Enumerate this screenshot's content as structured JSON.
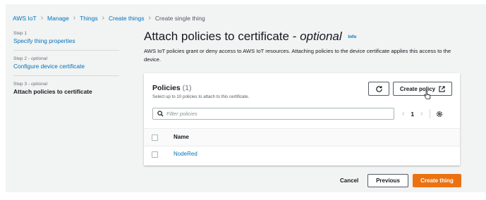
{
  "breadcrumb": {
    "items": [
      "AWS IoT",
      "Manage",
      "Things",
      "Create things"
    ],
    "current": "Create single thing"
  },
  "steps": [
    {
      "number": "Step 1",
      "optional": "",
      "title": "Specify thing properties"
    },
    {
      "number": "Step 2 - ",
      "optional": "optional",
      "title": "Configure device certificate"
    },
    {
      "number": "Step 3 - ",
      "optional": "optional",
      "title": "Attach policies to certificate"
    }
  ],
  "page": {
    "title": "Attach policies to certificate - ",
    "title_optional": "optional",
    "info_label": "Info",
    "description": "AWS IoT policies grant or deny access to AWS IoT resources. Attaching policies to the device certificate applies this access to the device."
  },
  "policies": {
    "title": "Policies",
    "count": "(1)",
    "description": "Select up to 10 policies to attach to this certificate.",
    "create_label": "Create policy",
    "filter_placeholder": "Filter policies",
    "page_number": "1",
    "column_name": "Name",
    "rows": [
      {
        "name": "NodeRed"
      }
    ]
  },
  "footer": {
    "cancel_label": "Cancel",
    "previous_label": "Previous",
    "create_label": "Create thing"
  },
  "colors": {
    "accent": "#0073bb",
    "primary_button": "#ec7211"
  },
  "icons": [
    "refresh-icon",
    "external-link-icon",
    "search-icon",
    "chevron-left-icon",
    "chevron-right-icon",
    "gear-icon",
    "pointer-cursor-icon"
  ]
}
